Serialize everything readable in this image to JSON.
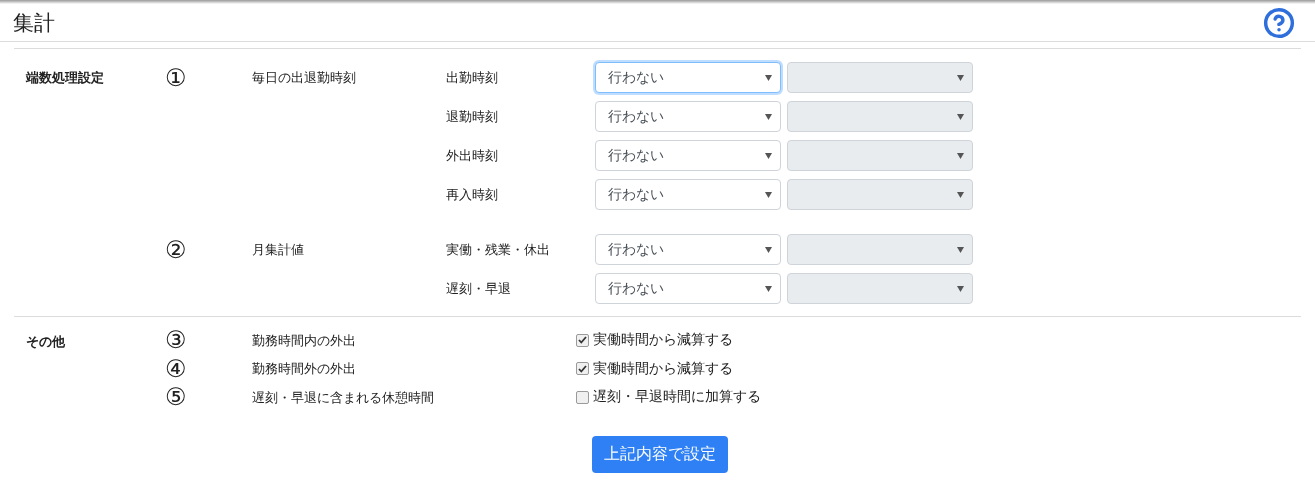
{
  "title": "集計",
  "sections": [
    {
      "kind": "rounding",
      "label": "端数処理設定",
      "groups": [
        {
          "number": "①",
          "label": "毎日の出退勤時刻",
          "rows": [
            {
              "label": "出勤時刻",
              "select": {
                "value": "行わない",
                "focused": true
              },
              "unit_select": {
                "disabled": true
              }
            },
            {
              "label": "退勤時刻",
              "select": {
                "value": "行わない",
                "focused": false
              },
              "unit_select": {
                "disabled": true
              }
            },
            {
              "label": "外出時刻",
              "select": {
                "value": "行わない",
                "focused": false
              },
              "unit_select": {
                "disabled": true
              }
            },
            {
              "label": "再入時刻",
              "select": {
                "value": "行わない",
                "focused": false
              },
              "unit_select": {
                "disabled": true
              }
            }
          ]
        },
        {
          "number": "②",
          "label": "月集計値",
          "rows": [
            {
              "label": "実働・残業・休出",
              "select": {
                "value": "行わない",
                "focused": false
              },
              "unit_select": {
                "disabled": true
              }
            },
            {
              "label": "遅刻・早退",
              "select": {
                "value": "行わない",
                "focused": false
              },
              "unit_select": {
                "disabled": true
              }
            }
          ]
        }
      ]
    },
    {
      "kind": "options",
      "label": "その他",
      "items": [
        {
          "number": "③",
          "label": "勤務時間内の外出",
          "checked": true,
          "option": "実働時間から減算する"
        },
        {
          "number": "④",
          "label": "勤務時間外の外出",
          "checked": true,
          "option": "実働時間から減算する"
        },
        {
          "number": "⑤",
          "label": "遅刻・早退に含まれる休憩時間",
          "checked": false,
          "option": "遅刻・早退時間に加算する"
        }
      ]
    }
  ],
  "submit": "上記内容で設定"
}
